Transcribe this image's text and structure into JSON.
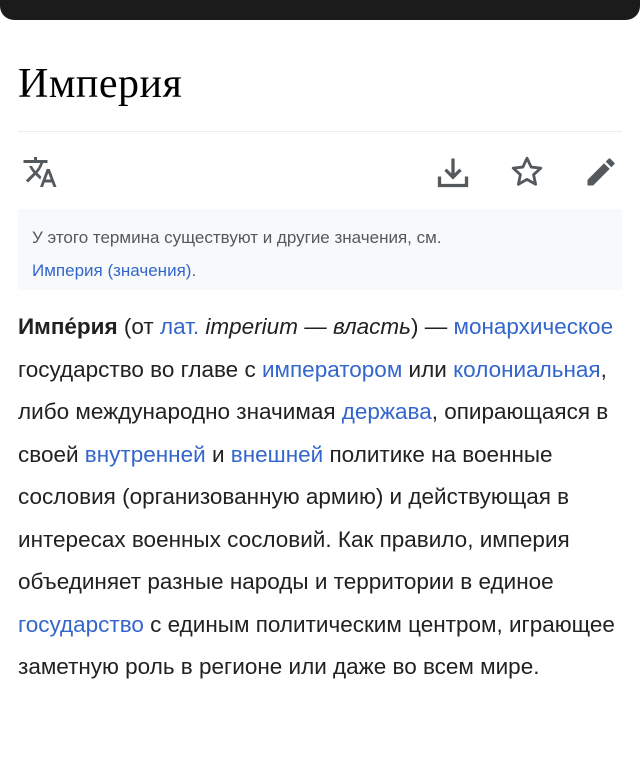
{
  "page": {
    "title": "Империя"
  },
  "toolbar": {
    "language_icon": "language-translate-icon",
    "download_icon": "download-icon",
    "watch_icon": "star-icon",
    "edit_icon": "pencil-edit-icon"
  },
  "hatnote": {
    "text": "У этого термина существуют и другие значения, см.",
    "link": "Империя (значения)",
    "end": "."
  },
  "article": {
    "term": "Импе́рия",
    "t1": " (от ",
    "lat_link": "лат.",
    "lat_word": " imperium — власть",
    "t2": ") — ",
    "link_monarch": "монархическое",
    "t3": " государство во главе с ",
    "link_emperor": "императором",
    "t4": " или ",
    "link_colonial": "колониальная",
    "t5": ", либо международно значимая ",
    "link_power": "держава",
    "t6": ", опирающаяся в своей ",
    "link_internal": "внутренней",
    "t7": " и ",
    "link_external": "внешней",
    "t8": " политике на военные сословия (организованную армию) и действующая в интересах военных сословий. Как правило, империя объединяет разные народы и территории в единое ",
    "link_state": "государство",
    "t9": " с единым политическим центром, играющее заметную роль в регионе или даже во всем мире."
  },
  "colors": {
    "link": "#3366cc",
    "text": "#202122",
    "hatnote_bg": "#f8f9fa",
    "icon": "#54595d"
  }
}
